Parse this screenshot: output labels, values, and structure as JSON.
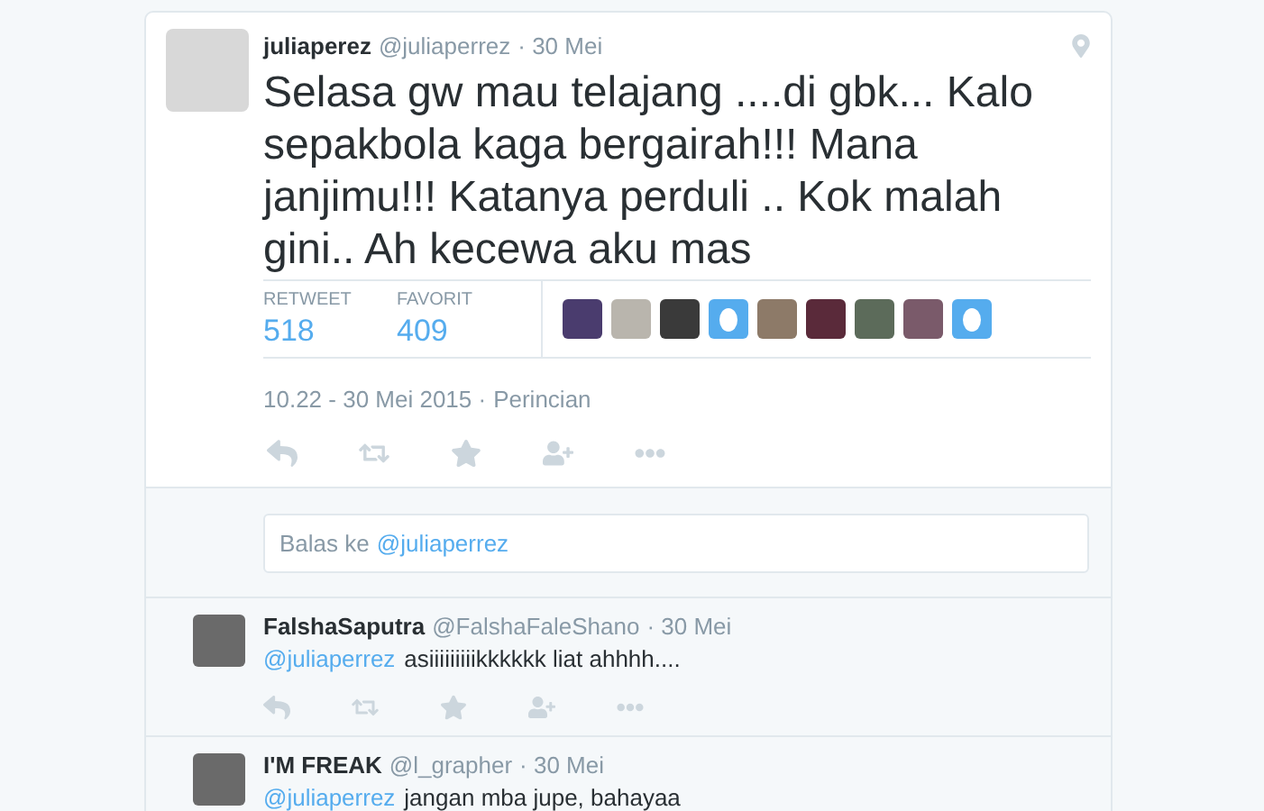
{
  "tweet": {
    "name": "juliaperez",
    "handle": "@juliaperrez",
    "time": "· 30 Mei",
    "text": "Selasa gw mau telajang ....di gbk... Kalo sepakbola kaga bergairah!!! Mana janjimu!!! Katanya perduli .. Kok malah gini.. Ah kecewa aku mas",
    "stats": [
      {
        "label": "RETWEET",
        "value": "518"
      },
      {
        "label": "FAVORIT",
        "value": "409"
      }
    ],
    "favoriters": [
      {
        "kind": "photo"
      },
      {
        "kind": "photo"
      },
      {
        "kind": "photo"
      },
      {
        "kind": "egg"
      },
      {
        "kind": "photo"
      },
      {
        "kind": "photo"
      },
      {
        "kind": "photo"
      },
      {
        "kind": "photo"
      },
      {
        "kind": "egg"
      }
    ],
    "timestamp": "10.22 - 30 Mei 2015 ·",
    "details_link": "Perincian"
  },
  "reply_box": {
    "placeholder": "Balas ke",
    "mention": "@juliaperrez"
  },
  "replies": [
    {
      "name": "FalshaSaputra",
      "handle": "@FalshaFaleShano",
      "time": "· 30 Mei",
      "mention": "@juliaperrez",
      "text": "asiiiiiiiiikkkkkk liat ahhhh...."
    },
    {
      "name": "I'M FREAK",
      "handle": "@l_grapher",
      "time": "· 30 Mei",
      "mention": "@juliaperrez",
      "text": "jangan mba jupe, bahayaa"
    }
  ]
}
